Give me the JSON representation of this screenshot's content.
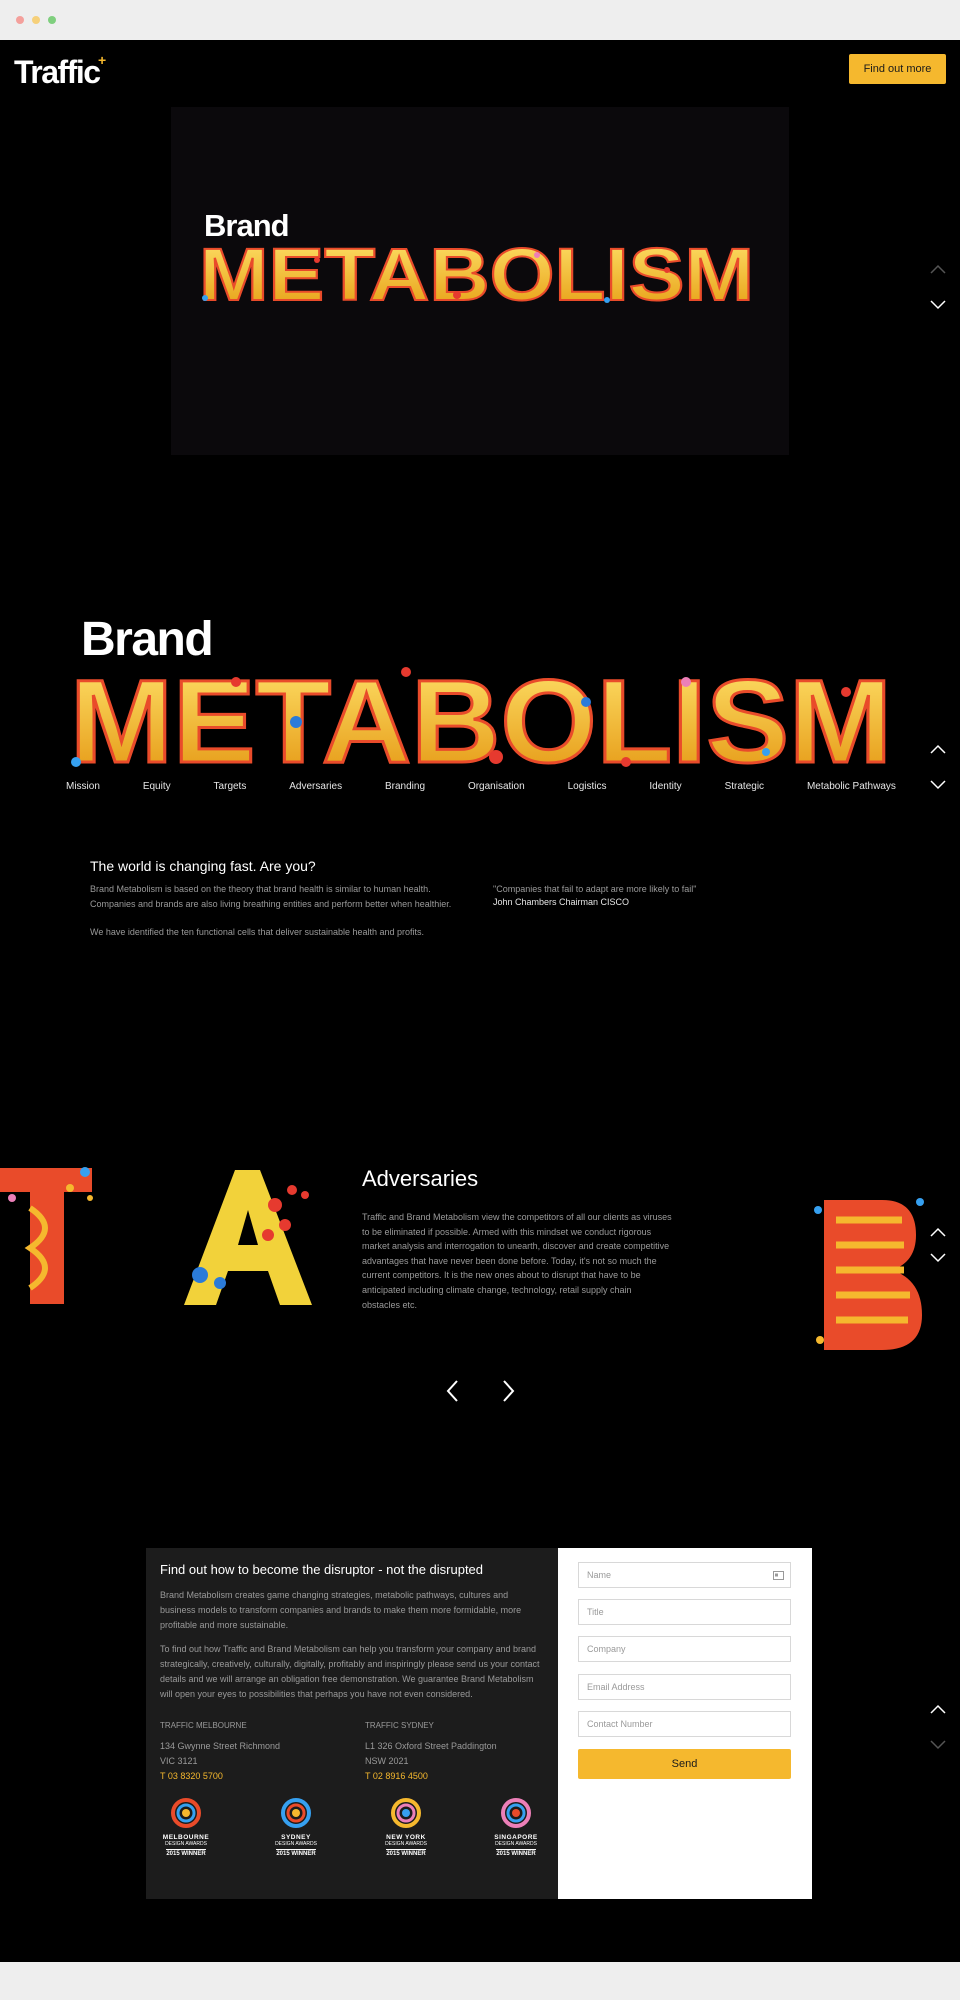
{
  "header": {
    "logo": "Traffic",
    "logo_mark": "+",
    "cta_label": "Find out more"
  },
  "hero": {
    "brand": "Brand",
    "word": "METABOLISM"
  },
  "overview": {
    "brand": "Brand",
    "word": "METABOLISM",
    "cells": [
      "Mission",
      "Equity",
      "Targets",
      "Adversaries",
      "Branding",
      "Organisation",
      "Logistics",
      "Identity",
      "Strategic",
      "Metabolic Pathways"
    ]
  },
  "intro": {
    "title": "The world is changing fast. Are you?",
    "p1": "Brand Metabolism is based on the theory that brand health is similar to human health. Companies and brands are also living breathing entities and perform better when healthier.",
    "p2": "We have identified the ten functional cells that deliver sustainable health and profits.",
    "quote": "\"Companies that fail to adapt are more likely to fail\"",
    "quote_by": "John Chambers Chairman CISCO"
  },
  "carousel": {
    "title": "Adversaries",
    "text": "Traffic and Brand Metabolism view the competitors of all our clients as viruses to be eliminated if possible. Armed with this mindset we conduct rigorous market analysis and interrogation to unearth, discover and create competitive advantages that have never been done before. Today, it's not so much the current competitors. It is the new ones about to disrupt that have to be anticipated including climate change, technology, retail supply chain obstacles etc."
  },
  "contact": {
    "title": "Find out how to become the disruptor - not the disrupted",
    "p1": "Brand Metabolism creates game changing strategies, metabolic pathways, cultures and business models to transform companies and brands to make them more formidable, more profitable and more sustainable.",
    "p2": "To find out how Traffic and Brand Metabolism can help you transform your company and brand strategically, creatively, culturally, digitally, profitably and inspiringly please send us your contact details and we will arrange an obligation free demonstration. We guarantee Brand Metabolism will open your eyes to possibilities that perhaps you have not even considered.",
    "offices": [
      {
        "head": "TRAFFIC MELBOURNE",
        "line1": "134 Gwynne Street Richmond",
        "line2": "VIC 3121",
        "phone": "T 03 8320 5700"
      },
      {
        "head": "TRAFFIC SYDNEY",
        "line1": "L1 326 Oxford Street Paddington",
        "line2": "NSW 2021",
        "phone": "T 02 8916 4500"
      }
    ],
    "awards": [
      {
        "city": "MELBOURNE",
        "line": "DESIGN AWARDS",
        "year": "2015 WINNER"
      },
      {
        "city": "SYDNEY",
        "line": "DESIGN AWARDS",
        "year": "2015 WINNER"
      },
      {
        "city": "NEW YORK",
        "line": "DESIGN AWARDS",
        "year": "2015 WINNER"
      },
      {
        "city": "SINGAPORE",
        "line": "DESIGN AWARDS",
        "year": "2015 WINNER"
      }
    ]
  },
  "form": {
    "name": "Name",
    "title": "Title",
    "company": "Company",
    "email": "Email Address",
    "contact": "Contact Number",
    "send": "Send"
  },
  "colors": {
    "accent": "#f5b82e",
    "background": "#000000",
    "panel": "#1c1c1c"
  }
}
